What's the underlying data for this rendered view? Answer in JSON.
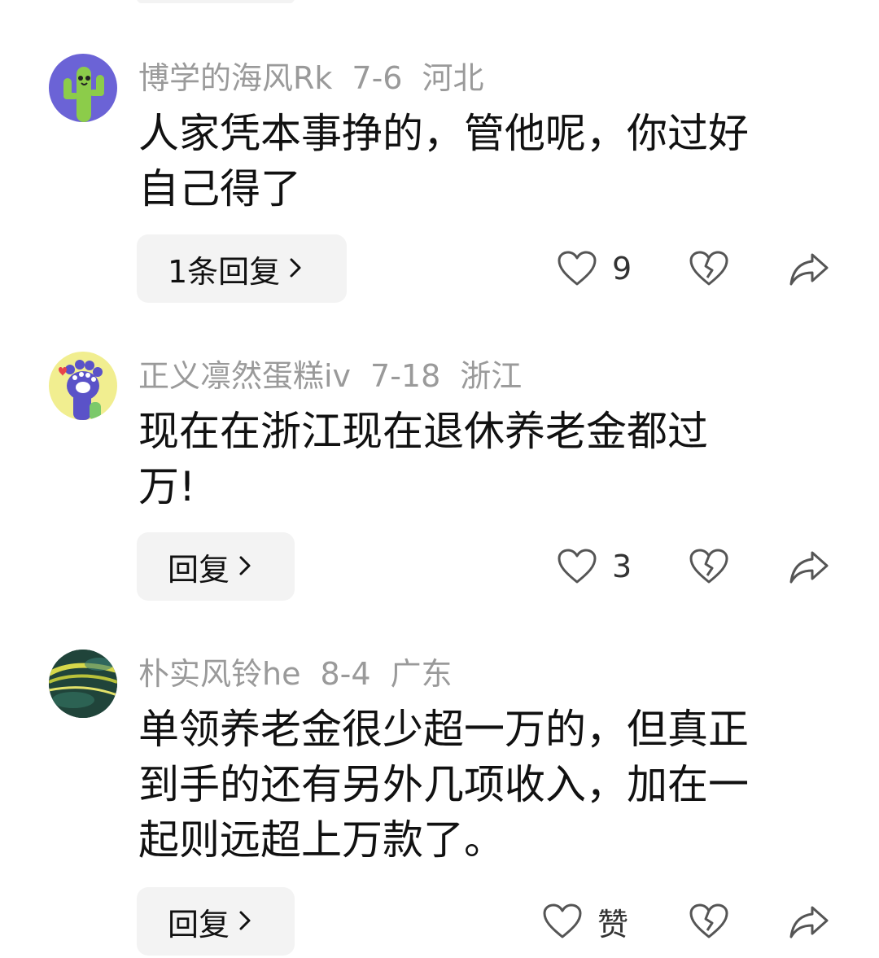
{
  "comments": [
    {
      "username": "博学的海风Rk",
      "date": "7-6",
      "location": "河北",
      "text": "人家凭本事挣的，管他呢，你过好\n自己得了",
      "reply_label": "1条回复",
      "like_count": "9"
    },
    {
      "username": "正义凛然蛋糕iv",
      "date": "7-18",
      "location": "浙江",
      "text": "现在在浙江现在退休养老金都过\n万!",
      "reply_label": "回复",
      "like_count": "3"
    },
    {
      "username": "朴实风铃he",
      "date": "8-4",
      "location": "广东",
      "text": "单领养老金很少超一万的，但真正\n到手的还有另外几项收入，加在一\n起则远超上万款了。",
      "reply_label": "回复",
      "like_count": "赞"
    }
  ],
  "icons": {
    "like": "heart-outline-icon",
    "dislike": "broken-heart-icon",
    "share": "share-arrow-icon",
    "reply_chevron": "chevron-right-icon"
  },
  "colors": {
    "text": "#111111",
    "meta": "#9a9a9a",
    "button_bg": "#f3f3f3",
    "icon": "#555555"
  }
}
